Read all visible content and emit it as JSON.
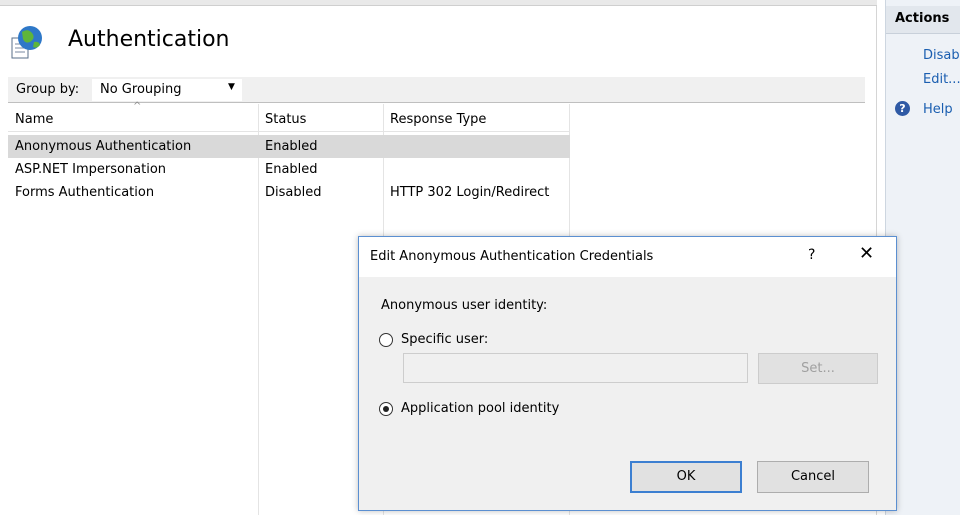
{
  "page": {
    "title": "Authentication"
  },
  "group_by": {
    "label": "Group by:",
    "value": "No Grouping"
  },
  "grid": {
    "columns": [
      "Name",
      "Status",
      "Response Type"
    ],
    "rows": [
      {
        "name": "Anonymous Authentication",
        "status": "Enabled",
        "response_type": ""
      },
      {
        "name": "ASP.NET Impersonation",
        "status": "Enabled",
        "response_type": ""
      },
      {
        "name": "Forms Authentication",
        "status": "Disabled",
        "response_type": "HTTP 302 Login/Redirect"
      }
    ]
  },
  "actions": {
    "title": "Actions",
    "disable": "Disab",
    "edit": "Edit...",
    "help": "Help"
  },
  "dialog": {
    "title": "Edit Anonymous Authentication Credentials",
    "help_glyph": "?",
    "close_glyph": "✕",
    "identity_label": "Anonymous user identity:",
    "specific_user_label": "Specific user:",
    "specific_user_value": "",
    "set_button": "Set...",
    "app_pool_label": "Application pool identity",
    "selected_option": "Application pool identity",
    "ok_button": "OK",
    "cancel_button": "Cancel"
  },
  "colors": {
    "link": "#1a5eb0",
    "selection": "#d9d9d9",
    "dialog_border": "#5b8fd1"
  }
}
